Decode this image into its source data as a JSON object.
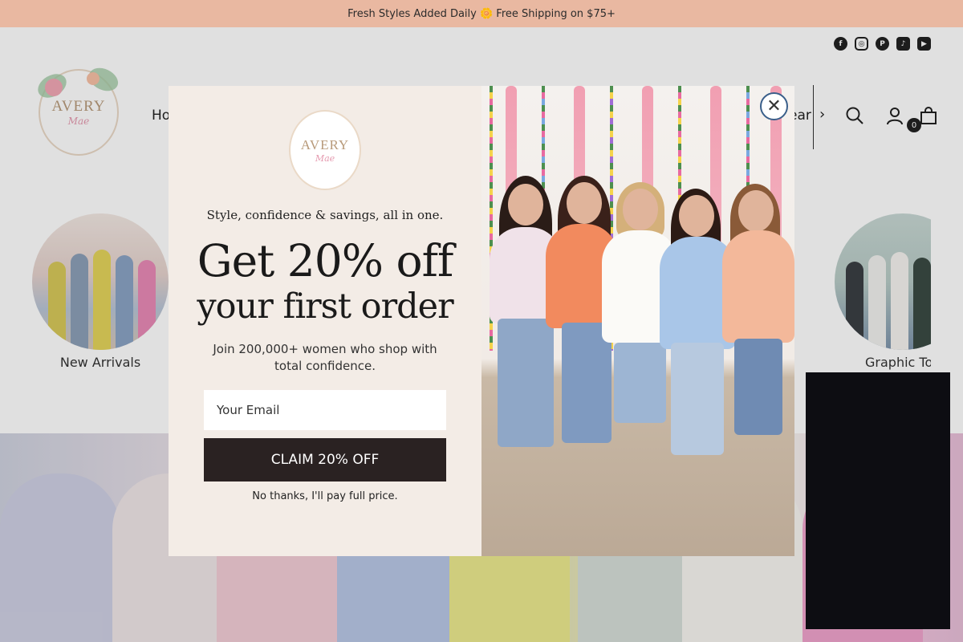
{
  "announcement": {
    "text": "Fresh Styles Added Daily 🌼 Free Shipping on $75+"
  },
  "header": {
    "logo_line1": "AVERY",
    "logo_line2": "Mae",
    "nav_partial_left": "Ho",
    "nav_partial_right": "ear",
    "social_icons": [
      "facebook-icon",
      "instagram-icon",
      "pinterest-icon",
      "tiktok-icon",
      "youtube-icon"
    ],
    "cart_count": "0"
  },
  "categories": [
    {
      "label": "New Arrivals"
    },
    {
      "label": "Graphic Top"
    }
  ],
  "popup": {
    "logo_line1": "AVERY",
    "logo_line2": "Mae",
    "tagline": "Style, confidence & savings, all in one.",
    "headline_line1": "Get 20% off",
    "headline_line2": "your first order",
    "subtext": "Join 200,000+ women who shop with total confidence.",
    "email_placeholder": "Your Email",
    "claim_button": "CLAIM 20% OFF",
    "decline_link": "No thanks, I'll pay full price.",
    "close_symbol": "✕"
  },
  "colors": {
    "announcement_bg": "#e9b8a1",
    "popup_bg": "#f3ece6",
    "button_bg": "#2a2222",
    "close_border": "#3a5f8a"
  }
}
